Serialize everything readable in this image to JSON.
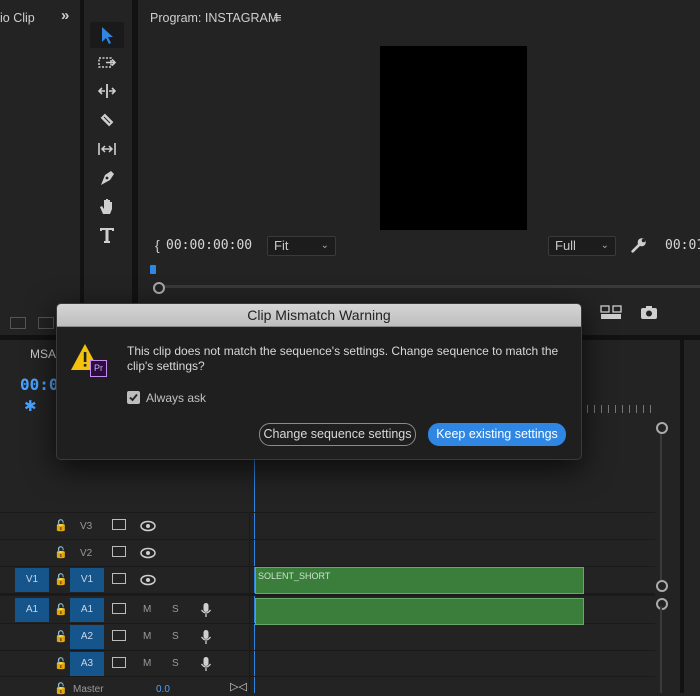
{
  "left_panel": {
    "title_fragment": "io Clip",
    "expand_glyph": "»"
  },
  "program_monitor": {
    "title": "Program: INSTAGRAM",
    "menu_glyph": "≡",
    "timecode_in": "00:00:00:00",
    "fit_value": "Fit",
    "quality_value": "Full",
    "timecode_out_fragment": "00:01"
  },
  "sequence_panel": {
    "tab_fragment": "MSA",
    "timecode_fragment": "00:0"
  },
  "dialog": {
    "title": "Clip Mismatch Warning",
    "badge": "Pr",
    "message": "This clip does not match the sequence's settings. Change sequence to match the clip's settings?",
    "always_ask_label": "Always ask",
    "always_ask_checked": true,
    "change_button": "Change sequence settings",
    "keep_button": "Keep existing settings"
  },
  "tracks": [
    {
      "name": "V3",
      "source": "",
      "type": "video"
    },
    {
      "name": "V2",
      "source": "",
      "type": "video"
    },
    {
      "name": "V1",
      "source": "V1",
      "type": "video"
    },
    {
      "name": "A1",
      "source": "A1",
      "type": "audio"
    },
    {
      "name": "A2",
      "source": "",
      "type": "audio"
    },
    {
      "name": "A3",
      "source": "",
      "type": "audio"
    }
  ],
  "track_buttons": {
    "mute": "M",
    "solo": "S"
  },
  "master": {
    "label": "Master",
    "value": "0.0"
  },
  "clip": {
    "label": "SOLENT_SHORT"
  },
  "colors": {
    "accent_blue": "#2f86e3",
    "clip_green": "#3b7d3b",
    "track_target": "#15558b",
    "timecode_blue": "#4aa3ff"
  }
}
